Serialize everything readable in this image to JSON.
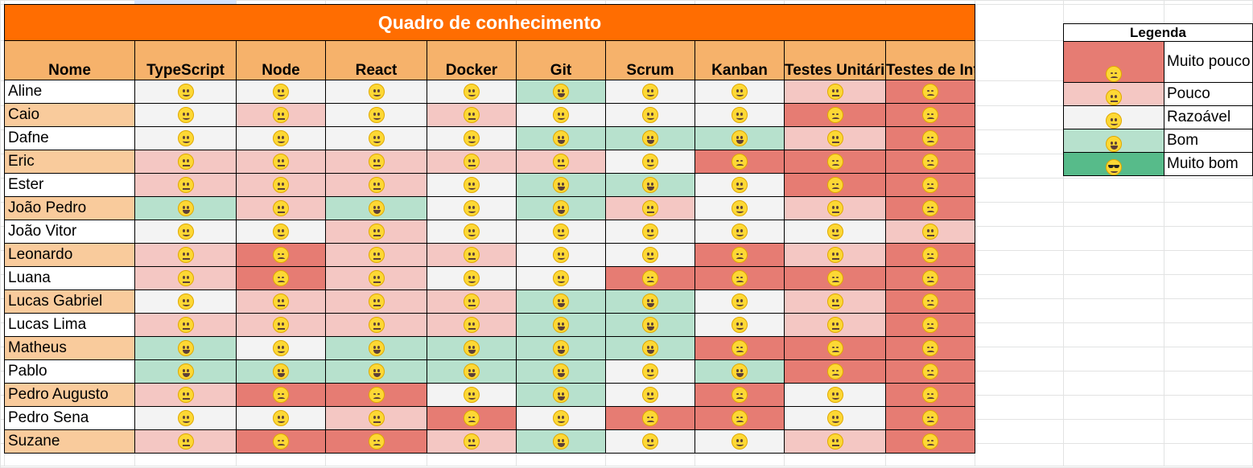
{
  "title": "Quadro de conhecimento",
  "headers": [
    "Nome",
    "TypeScript",
    "Node",
    "React",
    "Docker",
    "Git",
    "Scrum",
    "Kanban",
    "Testes Unitários",
    "Testes de Integração"
  ],
  "rows": [
    {
      "name": "Aline",
      "levels": [
        3,
        3,
        3,
        3,
        4,
        3,
        3,
        2,
        1
      ]
    },
    {
      "name": "Caio",
      "levels": [
        3,
        2,
        3,
        2,
        3,
        3,
        3,
        1,
        1
      ]
    },
    {
      "name": "Dafne",
      "levels": [
        3,
        3,
        3,
        3,
        4,
        4,
        4,
        2,
        1
      ]
    },
    {
      "name": "Eric",
      "levels": [
        2,
        2,
        2,
        2,
        2,
        3,
        1,
        1,
        1
      ]
    },
    {
      "name": "Ester",
      "levels": [
        2,
        2,
        2,
        3,
        4,
        4,
        3,
        1,
        1
      ]
    },
    {
      "name": "João Pedro",
      "levels": [
        4,
        2,
        4,
        3,
        4,
        2,
        3,
        2,
        1
      ]
    },
    {
      "name": "João Vitor",
      "levels": [
        3,
        3,
        2,
        3,
        3,
        3,
        3,
        3,
        2
      ]
    },
    {
      "name": "Leonardo",
      "levels": [
        2,
        1,
        2,
        2,
        3,
        3,
        1,
        2,
        1
      ]
    },
    {
      "name": "Luana",
      "levels": [
        2,
        1,
        2,
        3,
        3,
        1,
        1,
        1,
        1
      ]
    },
    {
      "name": "Lucas Gabriel",
      "levels": [
        3,
        2,
        2,
        2,
        4,
        4,
        3,
        2,
        1
      ]
    },
    {
      "name": "Lucas Lima",
      "levels": [
        2,
        2,
        2,
        2,
        4,
        4,
        3,
        2,
        1
      ]
    },
    {
      "name": "Matheus",
      "levels": [
        4,
        3,
        4,
        4,
        4,
        4,
        1,
        1,
        1
      ]
    },
    {
      "name": "Pablo",
      "levels": [
        4,
        4,
        4,
        4,
        4,
        3,
        4,
        1,
        1
      ]
    },
    {
      "name": "Pedro Augusto",
      "levels": [
        2,
        1,
        1,
        3,
        4,
        3,
        1,
        3,
        1
      ]
    },
    {
      "name": "Pedro Sena",
      "levels": [
        3,
        3,
        2,
        1,
        3,
        1,
        1,
        3,
        1
      ]
    },
    {
      "name": "Suzane",
      "levels": [
        2,
        1,
        1,
        2,
        4,
        3,
        3,
        2,
        1
      ]
    }
  ],
  "legend": {
    "title": "Legenda",
    "items": [
      {
        "level": 1,
        "label": "Muito pouco",
        "color": "#e67c73"
      },
      {
        "level": 2,
        "label": "Pouco",
        "color": "#f4c7c3"
      },
      {
        "level": 3,
        "label": "Razoável",
        "color": "#f3f3f3"
      },
      {
        "level": 4,
        "label": "Bom",
        "color": "#b7e1cd"
      },
      {
        "level": 5,
        "label": "Muito bom",
        "color": "#57bb8a"
      }
    ]
  },
  "emoji_icons": {
    "1": "tired-face-icon",
    "2": "neutral-face-icon",
    "3": "slightly-smiling-face-icon",
    "4": "grinning-face-icon",
    "5": "smiling-face-with-sunglasses-icon"
  }
}
